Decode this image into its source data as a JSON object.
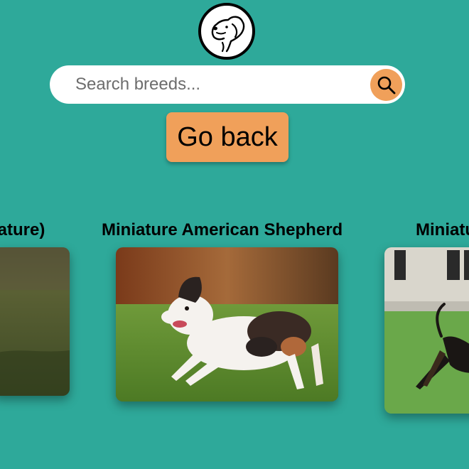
{
  "theme": {
    "background": "#2ea99a",
    "accent": "#f0a05a"
  },
  "search": {
    "placeholder": "Search breeds...",
    "button_icon": "search-icon"
  },
  "back_button": {
    "label": "Go back"
  },
  "breeds": [
    {
      "title": "iature)"
    },
    {
      "title": "Miniature American Shepherd"
    },
    {
      "title": "Miniatu"
    }
  ]
}
